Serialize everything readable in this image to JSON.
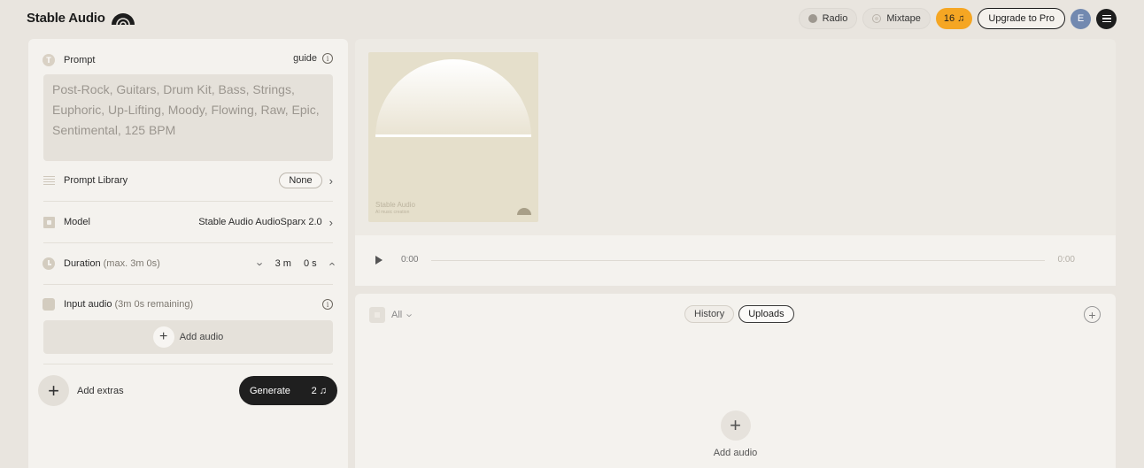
{
  "header": {
    "logo_text": "Stable Audio",
    "radio_label": "Radio",
    "mixtape_label": "Mixtape",
    "credits": "16",
    "upgrade_label": "Upgrade to Pro",
    "avatar_initial": "E",
    "accent_color": "#f5a623"
  },
  "prompt": {
    "label": "Prompt",
    "guide_label": "guide",
    "value": "Post-Rock, Guitars, Drum Kit, Bass, Strings, Euphoric, Up-Lifting, Moody, Flowing, Raw, Epic, Sentimental, 125 BPM"
  },
  "prompt_library": {
    "label": "Prompt Library",
    "value": "None"
  },
  "model": {
    "label": "Model",
    "value": "Stable Audio AudioSparx 2.0"
  },
  "duration": {
    "label": "Duration",
    "hint": "(max. 3m 0s)",
    "minutes": "3 m",
    "seconds": "0 s"
  },
  "input_audio": {
    "label": "Input audio",
    "hint": "(3m 0s remaining)",
    "add_label": "Add audio"
  },
  "extras": {
    "add_label": "Add extras"
  },
  "generate": {
    "label": "Generate",
    "cost": "2"
  },
  "artwork": {
    "caption": "Stable Audio",
    "subcaption": "AI music creation"
  },
  "player": {
    "current_time": "0:00",
    "total_time": "0:00"
  },
  "library": {
    "filter_label": "All",
    "tabs": [
      "History",
      "Uploads"
    ],
    "active_tab": "Uploads",
    "empty_add_label": "Add audio"
  }
}
